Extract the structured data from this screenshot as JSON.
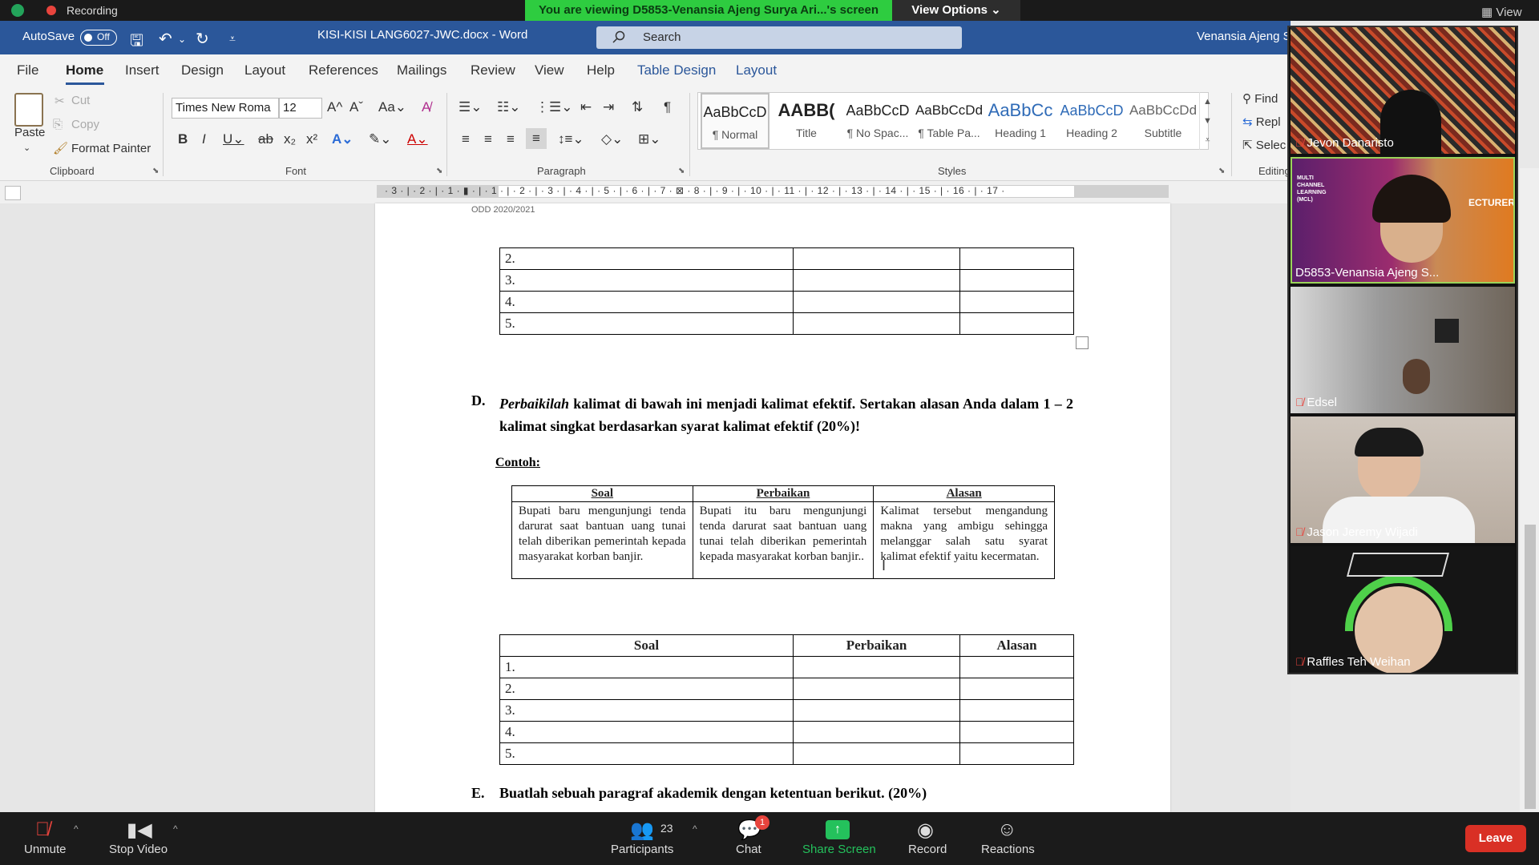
{
  "zoom": {
    "recording_label": "Recording",
    "viewing_banner": "You are viewing D5853-Venansia Ajeng Surya Ari...'s screen",
    "view_options": "View Options ⌄",
    "view_label": "View",
    "bottom": {
      "unmute": "Unmute",
      "stop_video": "Stop Video",
      "participants": "Participants",
      "participants_count": "23",
      "chat": "Chat",
      "chat_badge": "1",
      "share_screen": "Share Screen",
      "record": "Record",
      "reactions": "Reactions",
      "leave": "Leave"
    },
    "participants": [
      {
        "name": "Jevon Danaristo",
        "muted": true
      },
      {
        "name": "D5853-Venansia Ajeng S...",
        "muted": false
      },
      {
        "name": "Edsel",
        "muted": true
      },
      {
        "name": "Jason Jeremy Wijadi",
        "muted": true
      },
      {
        "name": "Raffles Teh Weihan",
        "muted": true
      }
    ],
    "lecturer_overlay": {
      "small": "MULTI CHANNEL LEARNING (MCL)",
      "big": "ECTURER"
    }
  },
  "word": {
    "autosave": "AutoSave",
    "autosave_state": "Off",
    "doc_title": "KISI-KISI LANG6027-JWC.docx  -  Word",
    "search_placeholder": "Search",
    "user": "Venansia Ajeng S",
    "tabs": [
      "File",
      "Home",
      "Insert",
      "Design",
      "Layout",
      "References",
      "Mailings",
      "Review",
      "View",
      "Help",
      "Table Design",
      "Layout"
    ],
    "clipboard": {
      "paste": "Paste",
      "cut": "Cut",
      "copy": "Copy",
      "format_painter": "Format Painter",
      "label": "Clipboard"
    },
    "font": {
      "name": "Times New Roma",
      "size": "12",
      "label": "Font"
    },
    "paragraph_label": "Paragraph",
    "styles": [
      {
        "preview": "AaBbCcD",
        "name": "¶ Normal"
      },
      {
        "preview": "AABB(",
        "name": "Title"
      },
      {
        "preview": "AaBbCcD",
        "name": "¶ No Spac..."
      },
      {
        "preview": "AaBbCcDd",
        "name": "¶ Table Pa..."
      },
      {
        "preview": "AaBbCc",
        "name": "Heading 1"
      },
      {
        "preview": "AaBbCcD",
        "name": "Heading 2"
      },
      {
        "preview": "AaBbCcDd",
        "name": "Subtitle"
      }
    ],
    "styles_label": "Styles",
    "editing": {
      "find": "Find",
      "replace": "Repl",
      "select": "Selec",
      "label": "Editing"
    },
    "ruler_text": "· 3 · | · 2 · | · 1 · ▮ · | · 1 · | · 2 · | · 3 · | · 4 · | · 5 · | · 6 · | · 7 · ⊠ · 8 · | · 9 · | · 10 · | · 11 · | · 12 · | · 13 · | · 14 · | · 15 · | · 16 · | · 17 ·"
  },
  "document": {
    "header": "ODD 2020/2021",
    "top_table_rows": [
      "2.",
      "3.",
      "4.",
      "5."
    ],
    "section_d": {
      "num": "D.",
      "italic_word": "Perbaikilah",
      "text": " kalimat di bawah ini menjadi kalimat efektif. Sertakan alasan Anda dalam 1 – 2 kalimat singkat berdasarkan syarat kalimat efektif (20%)!"
    },
    "contoh": "Contoh:",
    "example_headers": [
      "Soal",
      "Perbaikan",
      "Alasan"
    ],
    "example_row": [
      "Bupati baru mengunjungi tenda darurat saat bantuan uang tunai telah diberikan pemerintah kepada masyarakat korban banjir.",
      "Bupati itu baru mengunjungi tenda darurat saat bantuan uang tunai telah diberikan pemerintah kepada masyarakat korban banjir..",
      "Kalimat tersebut mengandung makna yang ambigu sehingga melanggar salah satu syarat kalimat efektif yaitu kecermatan."
    ],
    "answer_headers": [
      "Soal",
      "Perbaikan",
      "Alasan"
    ],
    "answer_rows": [
      "1.",
      "2.",
      "3.",
      "4.",
      "5."
    ],
    "section_e": {
      "num": "E.",
      "text": "Buatlah sebuah paragraf akademik dengan ketentuan berikut. (20%)"
    }
  }
}
